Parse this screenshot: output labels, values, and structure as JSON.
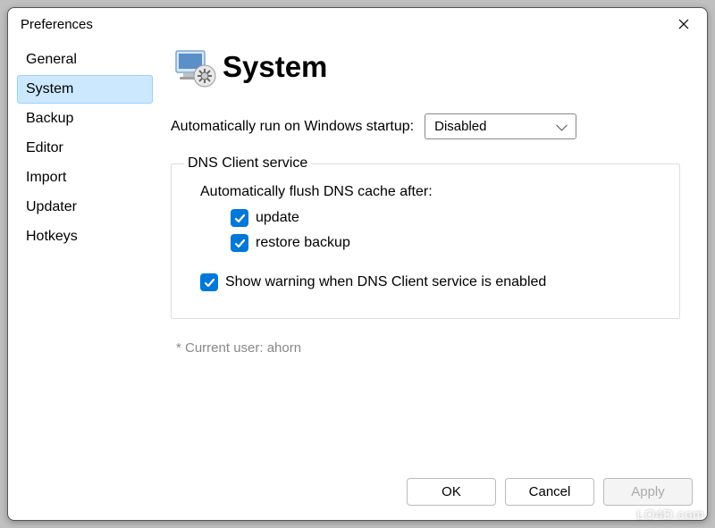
{
  "window": {
    "title": "Preferences"
  },
  "sidebar": {
    "items": [
      {
        "label": "General"
      },
      {
        "label": "System"
      },
      {
        "label": "Backup"
      },
      {
        "label": "Editor"
      },
      {
        "label": "Import"
      },
      {
        "label": "Updater"
      },
      {
        "label": "Hotkeys"
      }
    ],
    "selected_index": 1
  },
  "heading": "System",
  "startup": {
    "label": "Automatically run on Windows startup:",
    "value": "Disabled"
  },
  "dns_group": {
    "legend": "DNS Client service",
    "flush_label": "Automatically flush DNS cache after:",
    "update": {
      "label": "update",
      "checked": true
    },
    "restore_backup": {
      "label": "restore backup",
      "checked": true
    },
    "show_warning": {
      "label": "Show warning when DNS Client service is enabled",
      "checked": true
    }
  },
  "note_prefix": "* Current user: ",
  "current_user": "ahorn",
  "buttons": {
    "ok": "OK",
    "cancel": "Cancel",
    "apply": "Apply"
  },
  "watermark": "LO4D.com"
}
